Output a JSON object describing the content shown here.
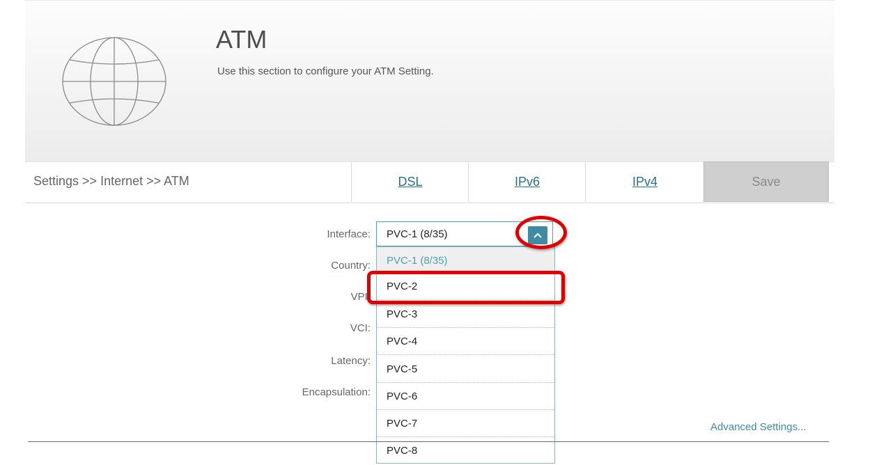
{
  "header": {
    "title": "ATM",
    "subtitle": "Use this section to configure your ATM Setting."
  },
  "nav": {
    "breadcrumb": "Settings >> Internet >> ATM",
    "tabs": [
      "DSL",
      "IPv6",
      "IPv4"
    ],
    "save_label": "Save"
  },
  "form": {
    "labels": {
      "interface": "Interface:",
      "country": "Country:",
      "vpi": "VPI:",
      "vci": "VCI:",
      "latency": "Latency:",
      "encapsulation": "Encapsulation:"
    },
    "interface_value": "PVC-1 (8/35)",
    "interface_options": [
      "PVC-1 (8/35)",
      "PVC-2",
      "PVC-3",
      "PVC-4",
      "PVC-5",
      "PVC-6",
      "PVC-7",
      "PVC-8"
    ],
    "advanced_link": "Advanced Settings..."
  },
  "colors": {
    "accent": "#3e8ba4",
    "highlight": "#e10000",
    "save_bg": "#cfcfcf"
  }
}
